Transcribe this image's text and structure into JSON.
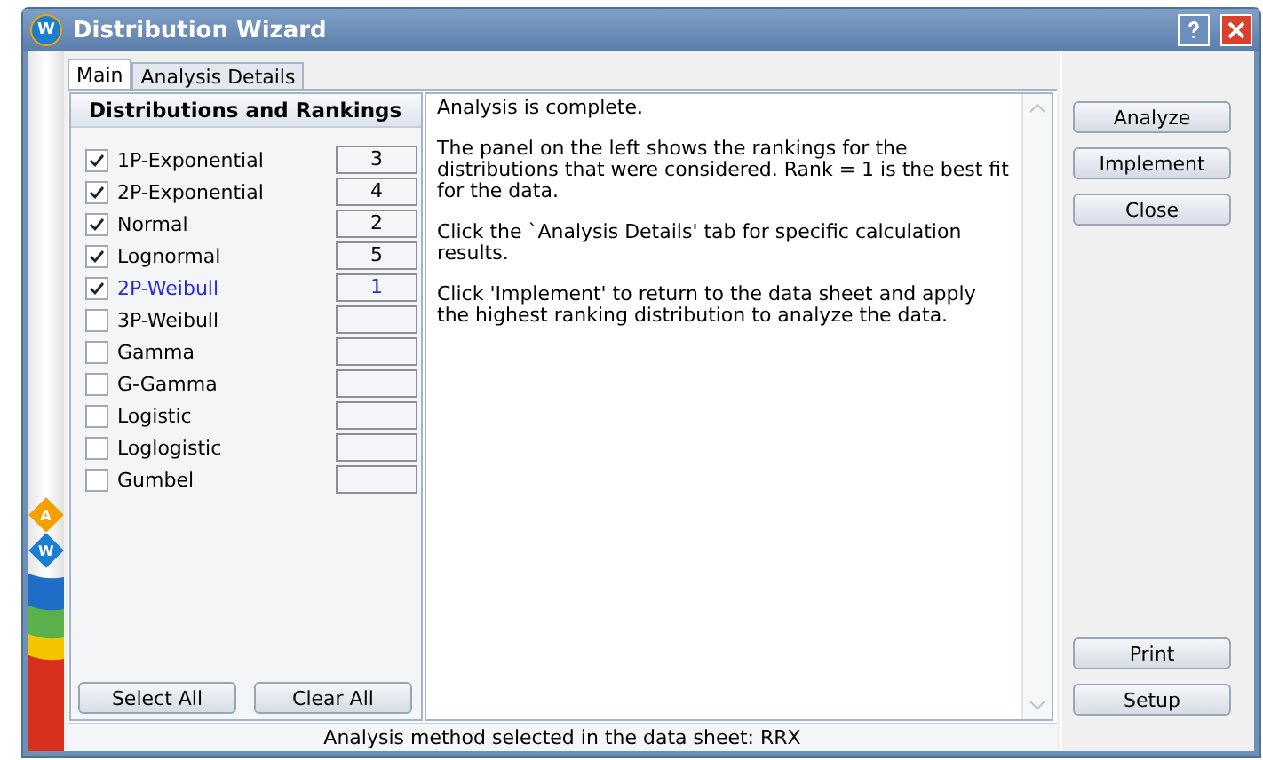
{
  "window": {
    "title": "Distribution Wizard",
    "icon_letter": "W"
  },
  "side_badges": [
    {
      "letter": "A",
      "color": "#f5a000"
    },
    {
      "letter": "W",
      "color": "#1a7fd0"
    }
  ],
  "tabs": [
    {
      "label": "Main",
      "selected": true
    },
    {
      "label": "Analysis Details",
      "selected": false
    }
  ],
  "distributions": {
    "title": "Distributions and Rankings",
    "items": [
      {
        "name": "1P-Exponential",
        "checked": true,
        "best": false,
        "rank": "3"
      },
      {
        "name": "2P-Exponential",
        "checked": true,
        "best": false,
        "rank": "4"
      },
      {
        "name": "Normal",
        "checked": true,
        "best": false,
        "rank": "2"
      },
      {
        "name": "Lognormal",
        "checked": true,
        "best": false,
        "rank": "5"
      },
      {
        "name": "2P-Weibull",
        "checked": true,
        "best": true,
        "rank": "1"
      },
      {
        "name": "3P-Weibull",
        "checked": false,
        "best": false
      },
      {
        "name": "Gamma",
        "checked": false,
        "best": false
      },
      {
        "name": "G-Gamma",
        "checked": false,
        "best": false
      },
      {
        "name": "Logistic",
        "checked": false,
        "best": false
      },
      {
        "name": "Loglogistic",
        "checked": false,
        "best": false
      },
      {
        "name": "Gumbel",
        "checked": false,
        "best": false
      }
    ],
    "buttons": [
      "Select All",
      "Clear All"
    ]
  },
  "message": [
    "Analysis is complete.",
    "The panel on the left shows the rankings for the distributions that were considered. Rank = 1 is the best fit for the data.",
    "Click the `Analysis Details' tab for specific calculation results.",
    "Click 'Implement' to return to the data sheet and apply the highest ranking distribution to analyze the data."
  ],
  "right_buttons_top": [
    "Analyze",
    "Implement",
    "Close"
  ],
  "right_buttons_bottom": [
    "Print",
    "Setup"
  ],
  "status_bar": "Analysis method selected in the data sheet: RRX"
}
